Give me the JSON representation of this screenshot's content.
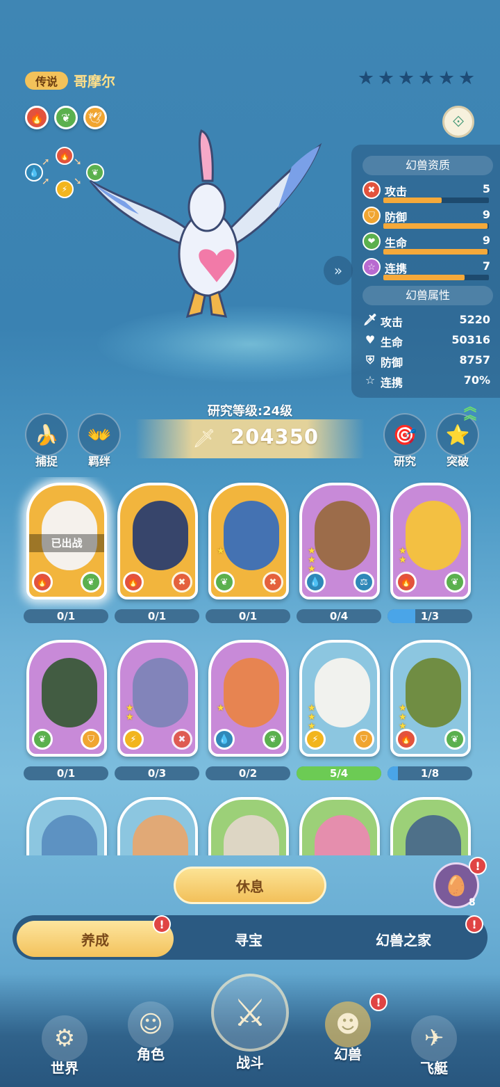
{
  "pet": {
    "rarity": "传说",
    "name": "哥摩尔",
    "stars": 6,
    "elements": [
      "fire-icon",
      "leaf-icon",
      "bird-icon"
    ]
  },
  "cycle": [
    "fire-icon",
    "leaf-icon",
    "bolt-icon",
    "water-icon"
  ],
  "quality": {
    "title": "幻兽资质",
    "rows": [
      {
        "label": "攻击",
        "value": "5",
        "level": 0.55,
        "icon": "attack-icon"
      },
      {
        "label": "防御",
        "value": "9",
        "level": 0.99,
        "icon": "defense-icon"
      },
      {
        "label": "生命",
        "value": "9",
        "level": 0.99,
        "icon": "life-icon"
      },
      {
        "label": "连携",
        "value": "7",
        "level": 0.77,
        "icon": "combo-icon"
      }
    ]
  },
  "attributes": {
    "title": "幻兽属性",
    "rows": [
      {
        "label": "攻击",
        "value": "5220",
        "icon": "sword-icon"
      },
      {
        "label": "生命",
        "value": "50316",
        "icon": "heart-icon"
      },
      {
        "label": "防御",
        "value": "8757",
        "icon": "shield-icon"
      },
      {
        "label": "连携",
        "value": "70%",
        "icon": "star-outline-icon"
      }
    ]
  },
  "research": {
    "level_text": "研究等级:24级",
    "power": "204350"
  },
  "actions": {
    "capture": "捕捉",
    "bond": "羁绊",
    "research": "研究",
    "breakthrough": "突破"
  },
  "cards": [
    {
      "color": "gold",
      "stars": 0,
      "left": "fire",
      "right": "leaf",
      "badge": "已出战",
      "progress": "0/1",
      "fill": 0
    },
    {
      "color": "gold",
      "stars": 0,
      "left": "fire",
      "right": "cross",
      "progress": "0/1",
      "fill": 0
    },
    {
      "color": "gold",
      "stars": 1,
      "left": "leaf",
      "right": "cross",
      "progress": "0/1",
      "fill": 0
    },
    {
      "color": "purple",
      "stars": 3,
      "left": "water",
      "right": "scale",
      "progress": "0/4",
      "fill": 0
    },
    {
      "color": "purple",
      "stars": 2,
      "left": "fire",
      "right": "leaf",
      "progress": "1/3",
      "fill": 0.33
    },
    {
      "color": "purple",
      "stars": 0,
      "left": "leaf",
      "right": "shield",
      "progress": "0/1",
      "fill": 0
    },
    {
      "color": "purple",
      "stars": 2,
      "left": "bolt",
      "right": "cross",
      "progress": "0/3",
      "fill": 0
    },
    {
      "color": "purple",
      "stars": 1,
      "left": "water",
      "right": "leaf",
      "progress": "0/2",
      "fill": 0
    },
    {
      "color": "blue",
      "stars": 3,
      "left": "bolt",
      "right": "shield",
      "progress": "5/4",
      "fill": 1
    },
    {
      "color": "blue",
      "stars": 4,
      "left": "fire",
      "right": "leaf",
      "progress": "1/8",
      "fill": 0.125
    },
    {
      "color": "blue",
      "stars": 0
    },
    {
      "color": "blue",
      "stars": 0
    },
    {
      "color": "green",
      "stars": 1
    },
    {
      "color": "green",
      "stars": 1
    },
    {
      "color": "green",
      "stars": 1
    }
  ],
  "rest_button": "休息",
  "egg_count": "8",
  "tabs": [
    "养成",
    "寻宝",
    "幻兽之家"
  ],
  "nav": [
    "世界",
    "角色",
    "战斗",
    "幻兽",
    "飞艇"
  ],
  "alert_mark": "!"
}
